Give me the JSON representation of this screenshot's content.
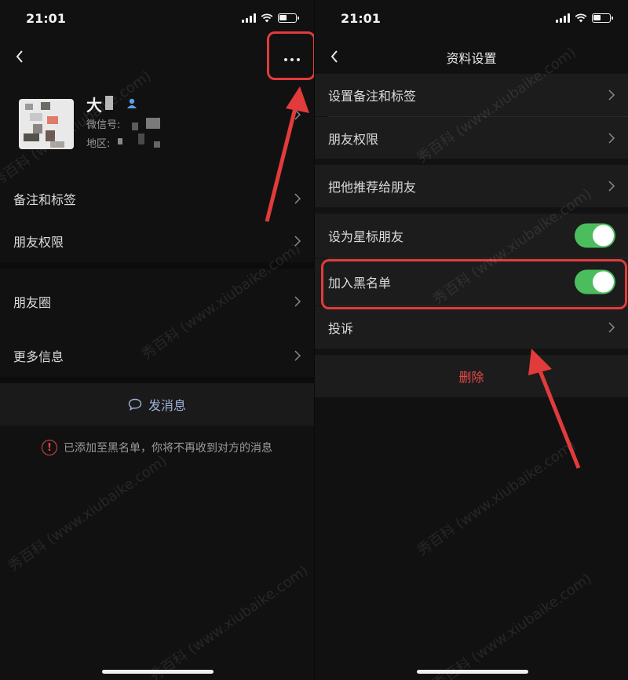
{
  "status_bar": {
    "time": "21:01"
  },
  "left": {
    "profile": {
      "name": "大",
      "wechat_id_label": "微信号:",
      "region_label": "地区:"
    },
    "rows": [
      {
        "label": "备注和标签"
      },
      {
        "label": "朋友权限"
      },
      {
        "label": "朋友圈"
      },
      {
        "label": "更多信息"
      }
    ],
    "send_message": "发消息",
    "blacklist_notice": "已添加至黑名单，你将不再收到对方的消息",
    "notice_icon": "!"
  },
  "right": {
    "title": "资料设置",
    "rows": [
      {
        "label": "设置备注和标签"
      },
      {
        "label": "朋友权限"
      },
      {
        "label": "把他推荐给朋友"
      },
      {
        "label": "设为星标朋友",
        "toggle_on": true
      },
      {
        "label": "加入黑名单",
        "toggle_on": true
      },
      {
        "label": "投诉"
      }
    ],
    "delete": "删除"
  },
  "watermark": {
    "text": "秀百科 (www.xiubaike.com)"
  },
  "colors": {
    "background": "#111111",
    "row": "#1c1c1c",
    "toggle": "#4bbd5d",
    "highlight": "#e23b3b",
    "delete": "#e64b4b",
    "send": "#9fb3d9"
  },
  "icons": [
    "back-icon",
    "more-icon",
    "chevron-right-icon",
    "chat-bubble-icon",
    "warning-icon",
    "user-icon",
    "signal-icon",
    "wifi-icon",
    "battery-icon"
  ]
}
